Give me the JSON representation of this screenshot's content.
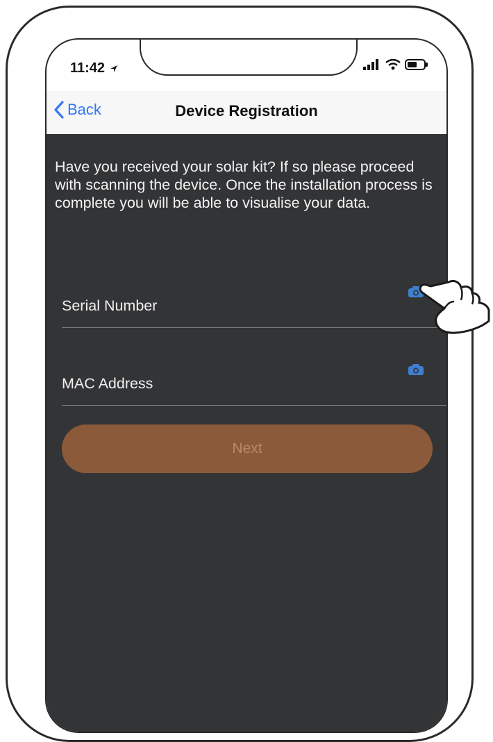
{
  "status": {
    "time": "11:42"
  },
  "nav": {
    "back_label": "Back",
    "title": "Device Registration"
  },
  "intro": "Have you received your solar kit? If so please proceed with scanning the device. Once the installation process is complete you will be able to visualise your data.",
  "fields": [
    {
      "label": "Serial Number"
    },
    {
      "label": "MAC Address"
    }
  ],
  "next_label": "Next",
  "colors": {
    "accent": "#3478f6",
    "background": "#333436",
    "button": "#8b5a3a"
  }
}
